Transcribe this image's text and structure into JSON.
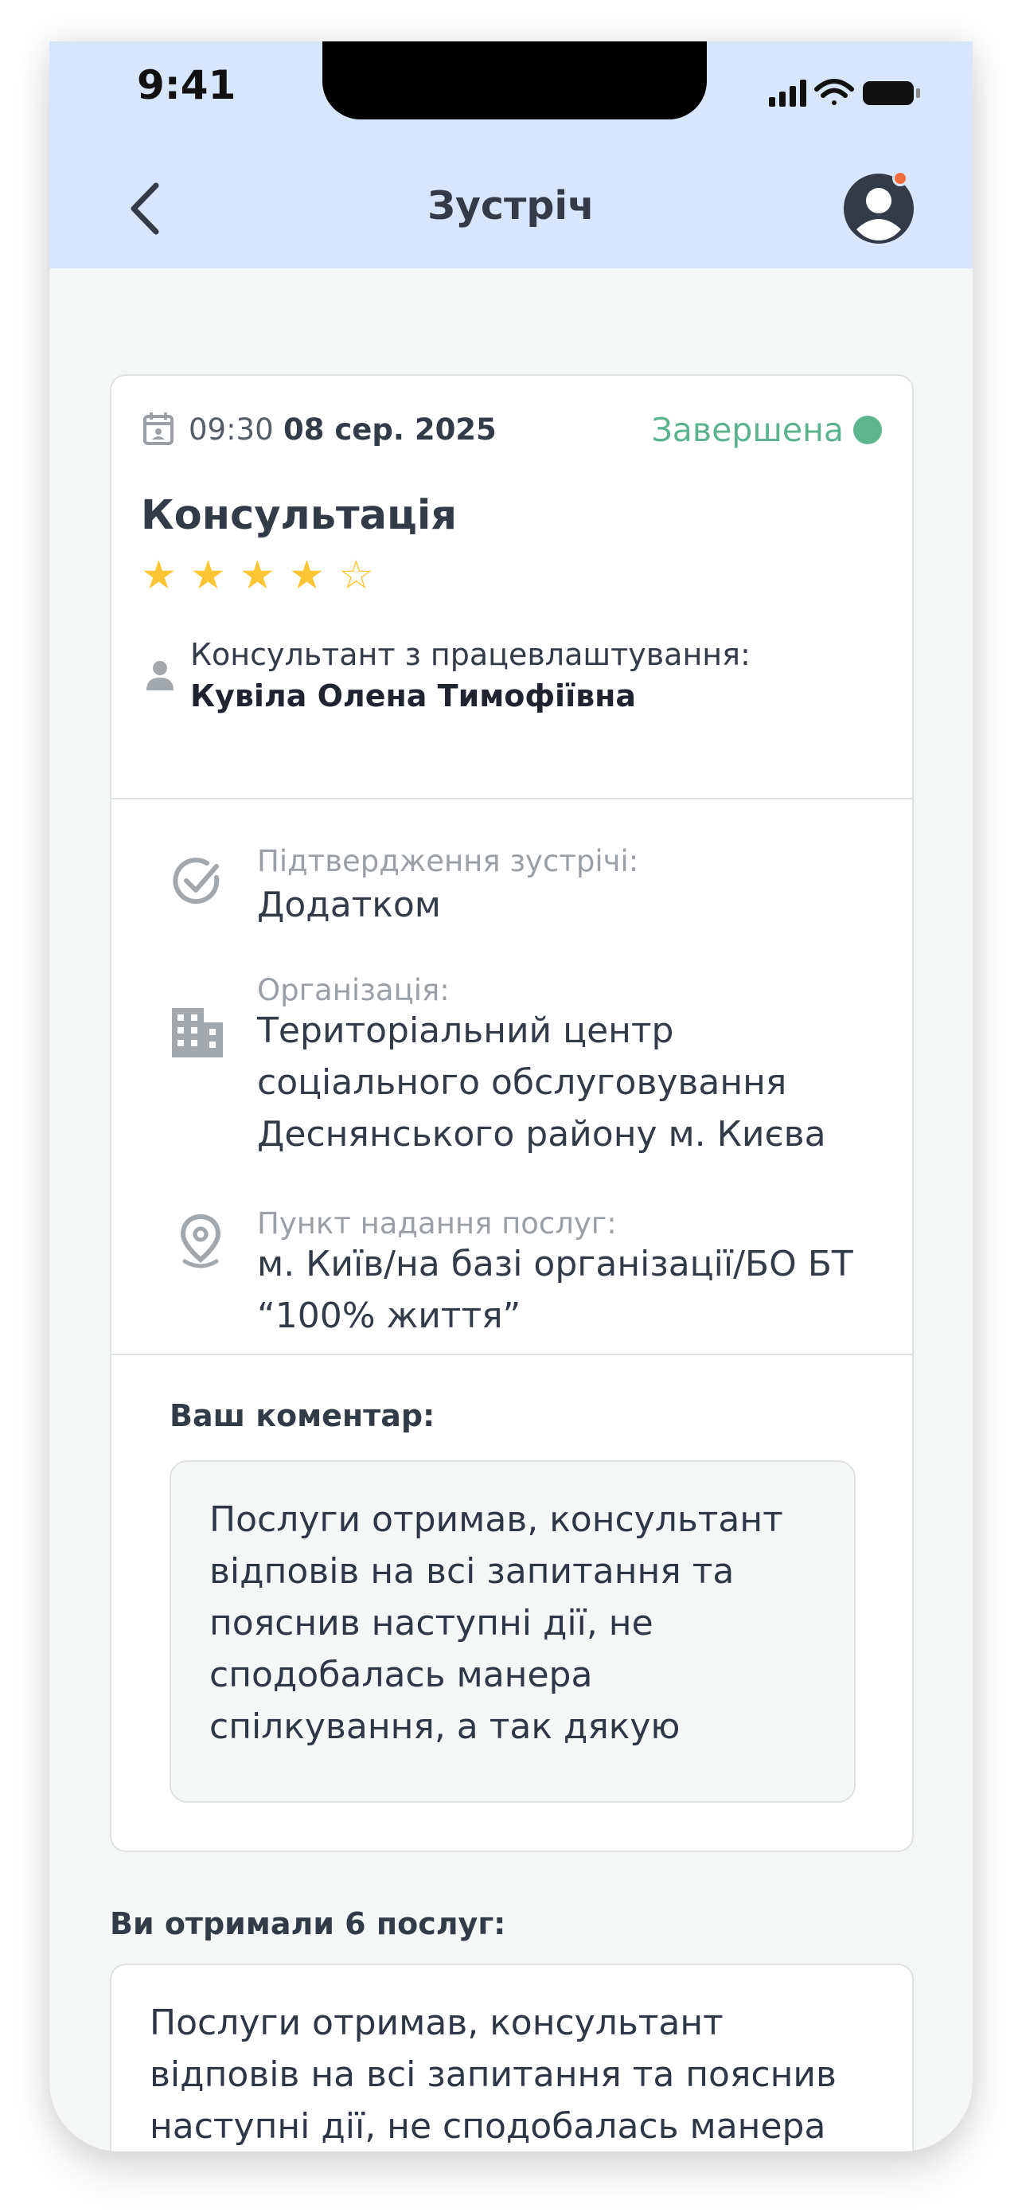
{
  "status_bar": {
    "time": "9:41"
  },
  "nav": {
    "title": "Зустріч"
  },
  "meeting": {
    "time": "09:30",
    "date": "08 сер. 2025",
    "status": "Завершена",
    "status_color": "#5fb58e",
    "service": "Консультація",
    "rating": 4,
    "rating_max": 5,
    "stars": [
      "★",
      "★",
      "★",
      "★",
      "☆"
    ],
    "consultant_role": "Консультант з працевлаштування:",
    "consultant_name": "Кувіла Олена Тимофіївна"
  },
  "details": {
    "confirmation_label": "Підтвердження зустрічі:",
    "confirmation_value": "Додатком",
    "organization_label": "Організація:",
    "organization_value": "Територіальний центр соціального обслуговування Деснянського району м. Києва",
    "service_point_label": "Пункт надання послуг:",
    "service_point_value": "м. Київ/на базі організації/БО БТ “100% життя”"
  },
  "comment": {
    "label": "Ваш коментар:",
    "text": "Послуги отримав, консультант відповів на всі запитання та пояснив наступні дії, не сподобалась манера спілкування, а так дякую"
  },
  "services": {
    "label": "Ви отримали 6 послуг:",
    "text": "Послуги отримав, консультант відповів на всі запитання та пояснив наступні дії, не сподобалась манера"
  },
  "colors": {
    "header_bg": "#d7e6fb",
    "accent_green": "#5db38f",
    "star": "#fbc535",
    "notification_dot": "#f56d3f"
  }
}
